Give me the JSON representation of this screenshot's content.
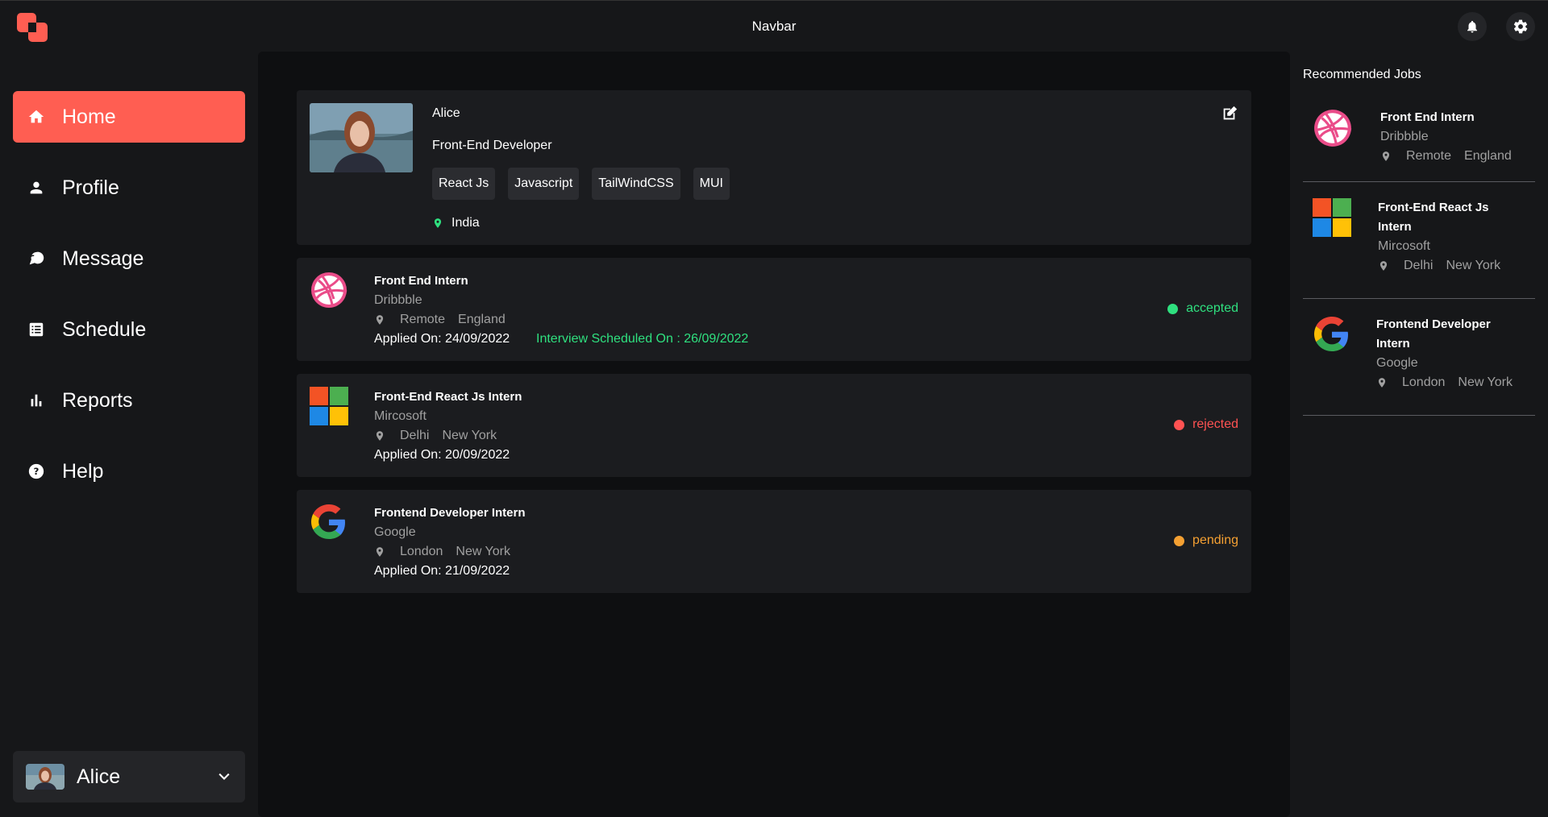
{
  "navbar": {
    "title": "Navbar"
  },
  "sidebar": {
    "items": [
      {
        "label": "Home",
        "icon": "home-icon",
        "active": true
      },
      {
        "label": "Profile",
        "icon": "person-icon"
      },
      {
        "label": "Message",
        "icon": "chat-icon"
      },
      {
        "label": "Schedule",
        "icon": "list-icon"
      },
      {
        "label": "Reports",
        "icon": "bar-chart-icon"
      },
      {
        "label": "Help",
        "icon": "help-icon"
      }
    ],
    "user": {
      "name": "Alice"
    }
  },
  "profile": {
    "name": "Alice",
    "role": "Front-End Developer",
    "skills": [
      "React Js",
      "Javascript",
      "TailWindCSS",
      "MUI"
    ],
    "location": "India"
  },
  "applications": [
    {
      "title": "Front End Intern",
      "company": "Dribbble",
      "logo": "dribbble-logo",
      "location": [
        "Remote",
        "England"
      ],
      "applied": "Applied On: 24/09/2022",
      "interview": "Interview Scheduled On : 26/09/2022",
      "status": "accepted",
      "status_color": "#2fe07f"
    },
    {
      "title": "Front-End React Js Intern",
      "company": "Mircosoft",
      "logo": "microsoft-logo",
      "location": [
        "Delhi",
        "New York"
      ],
      "applied": "Applied On: 20/09/2022",
      "status": "rejected",
      "status_color": "#ff5252"
    },
    {
      "title": "Frontend Developer Intern",
      "company": "Google",
      "logo": "google-logo",
      "location": [
        "London",
        "New York"
      ],
      "applied": "Applied On: 21/09/2022",
      "status": "pending",
      "status_color": "#f5a032"
    }
  ],
  "recommended": {
    "title": "Recommended Jobs",
    "jobs": [
      {
        "title": "Front End Intern",
        "company": "Dribbble",
        "location": [
          "Remote",
          "England"
        ]
      },
      {
        "title": "Front-End React Js Intern",
        "company": "Mircosoft",
        "location": [
          "Delhi",
          "New York"
        ]
      },
      {
        "title": "Frontend Developer Intern",
        "company": "Google",
        "location": [
          "London",
          "New York"
        ]
      }
    ]
  },
  "colors": {
    "accent": "#ff5e52",
    "accepted": "#2fe07f",
    "rejected": "#ff5252",
    "pending": "#f5a032"
  }
}
